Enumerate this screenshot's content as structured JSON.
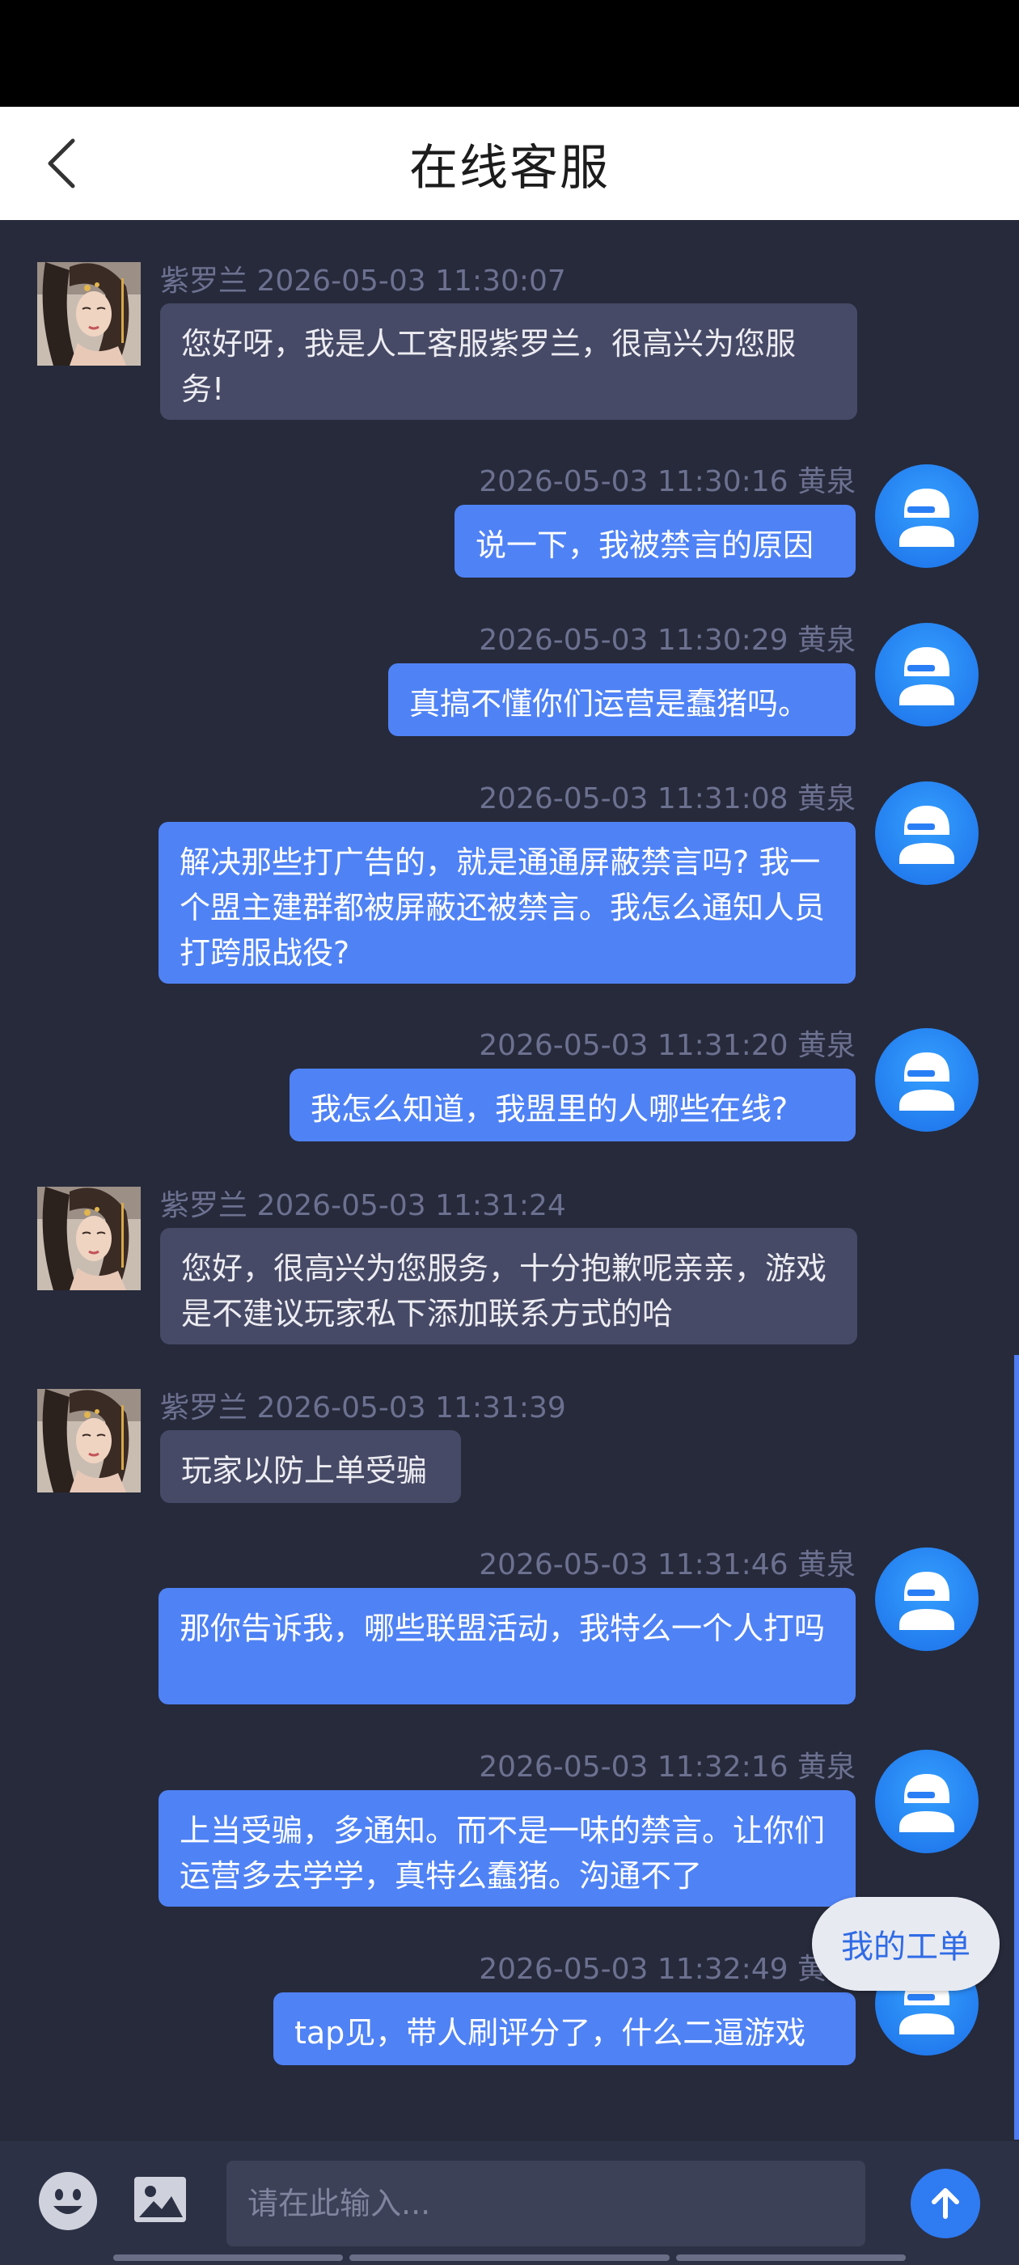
{
  "header": {
    "title": "在线客服"
  },
  "messages": [
    {
      "side": "agent",
      "name": "紫罗兰",
      "time": "2026-05-03 11:30:07",
      "text": "您好呀，我是人工客服紫罗兰，很高兴为您服务!"
    },
    {
      "side": "user",
      "name": "黄泉",
      "time": "2026-05-03 11:30:16",
      "text": "说一下，我被禁言的原因"
    },
    {
      "side": "user",
      "name": "黄泉",
      "time": "2026-05-03 11:30:29",
      "text": "真搞不懂你们运营是蠢猪吗。"
    },
    {
      "side": "user",
      "name": "黄泉",
      "time": "2026-05-03 11:31:08",
      "text": "解决那些打广告的，就是通通屏蔽禁言吗? 我一个盟主建群都被屏蔽还被禁言。我怎么通知人员打跨服战役?"
    },
    {
      "side": "user",
      "name": "黄泉",
      "time": "2026-05-03 11:31:20",
      "text": "我怎么知道，我盟里的人哪些在线?"
    },
    {
      "side": "agent",
      "name": "紫罗兰",
      "time": "2026-05-03 11:31:24",
      "text": "您好，很高兴为您服务，十分抱歉呢亲亲，游戏是不建议玩家私下添加联系方式的哈"
    },
    {
      "side": "agent",
      "name": "紫罗兰",
      "time": "2026-05-03 11:31:39",
      "text": "玩家以防上单受骗"
    },
    {
      "side": "user",
      "name": "黄泉",
      "time": "2026-05-03 11:31:46",
      "text": "那你告诉我，哪些联盟活动，我特么一个人打吗"
    },
    {
      "side": "user",
      "name": "黄泉",
      "time": "2026-05-03 11:32:16",
      "text": "上当受骗，多通知。而不是一味的禁言。让你们运营多去学学，真特么蠢猪。沟通不了"
    },
    {
      "side": "user",
      "name": "黄泉",
      "time": "2026-05-03 11:32:49",
      "text": "tap见，带人刷评分了，什么二逼游戏"
    }
  ],
  "ticket_button": {
    "label": "我的工单"
  },
  "input": {
    "placeholder": "请在此输入..."
  },
  "colors": {
    "background": "#262a3b",
    "user_bubble": "#4f82f5",
    "agent_bubble": "#474a66",
    "accent": "#2f7bf2"
  },
  "icons": {
    "back": "chevron-left-icon",
    "emoji": "smiley-icon",
    "image": "image-icon",
    "send": "arrow-up-icon",
    "user_avatar": "user-cap-icon"
  }
}
